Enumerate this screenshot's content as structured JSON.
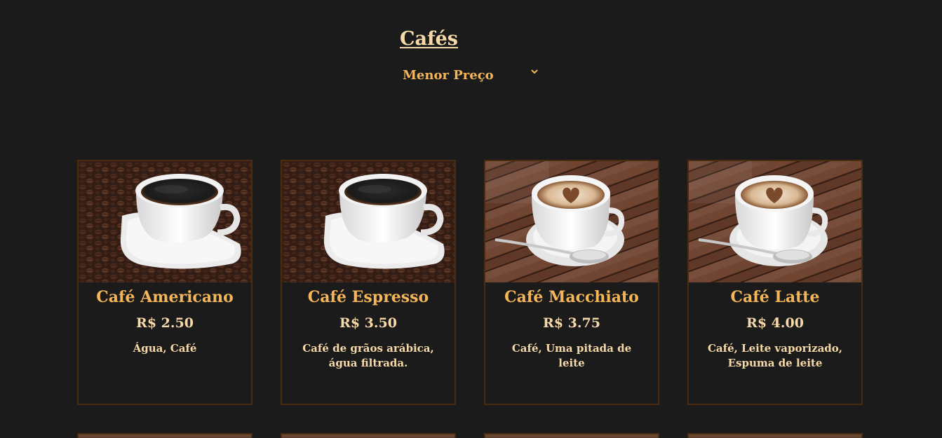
{
  "header": {
    "title": "Cafés",
    "sort": {
      "selected": "Menor Preço"
    }
  },
  "products": [
    {
      "name": "Café Americano",
      "price": "R$ 2.50",
      "description": "Água, Café",
      "image": "black-coffee-cup-on-beans"
    },
    {
      "name": "Café Espresso",
      "price": "R$ 3.50",
      "description": "Café de grãos arábica, água filtrada.",
      "image": "black-coffee-cup-on-beans"
    },
    {
      "name": "Café Macchiato",
      "price": "R$ 3.75",
      "description": "Café, Uma pitada de leite",
      "image": "cappuccino-heart-art-on-wood-table"
    },
    {
      "name": "Café Latte",
      "price": "R$ 4.00",
      "description": "Café, Leite vaporizado, Espuma de leite",
      "image": "cappuccino-heart-art-on-wood-table"
    }
  ],
  "colors": {
    "background": "#1b1b1b",
    "accent": "#f5b65a",
    "text_light": "#f6d9a8",
    "card_border": "#4a2c10"
  }
}
